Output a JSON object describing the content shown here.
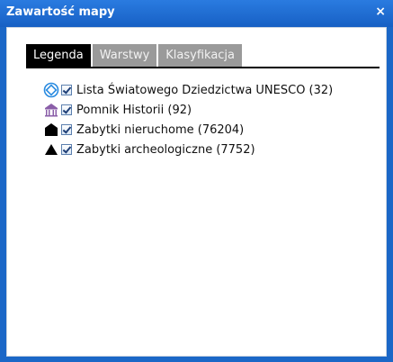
{
  "window": {
    "title": "Zawartość mapy",
    "close_symbol": "×"
  },
  "tabs": [
    {
      "label": "Legenda",
      "active": true
    },
    {
      "label": "Warstwy",
      "active": false
    },
    {
      "label": "Klasyfikacja",
      "active": false
    }
  ],
  "legend": [
    {
      "label": "Lista Światowego Dziedzictwa UNESCO (32)",
      "icon": "unesco-icon",
      "checked": true
    },
    {
      "label": "Pomnik Historii (92)",
      "icon": "pomnik-historii-icon",
      "checked": true
    },
    {
      "label": "Zabytki nieruchome (76204)",
      "icon": "building-icon",
      "checked": true
    },
    {
      "label": "Zabytki archeologiczne (7752)",
      "icon": "triangle-icon",
      "checked": true
    }
  ],
  "colors": {
    "titlebar": "#1b67c7",
    "active_tab": "#000000",
    "inactive_tab": "#9a9a9a"
  }
}
